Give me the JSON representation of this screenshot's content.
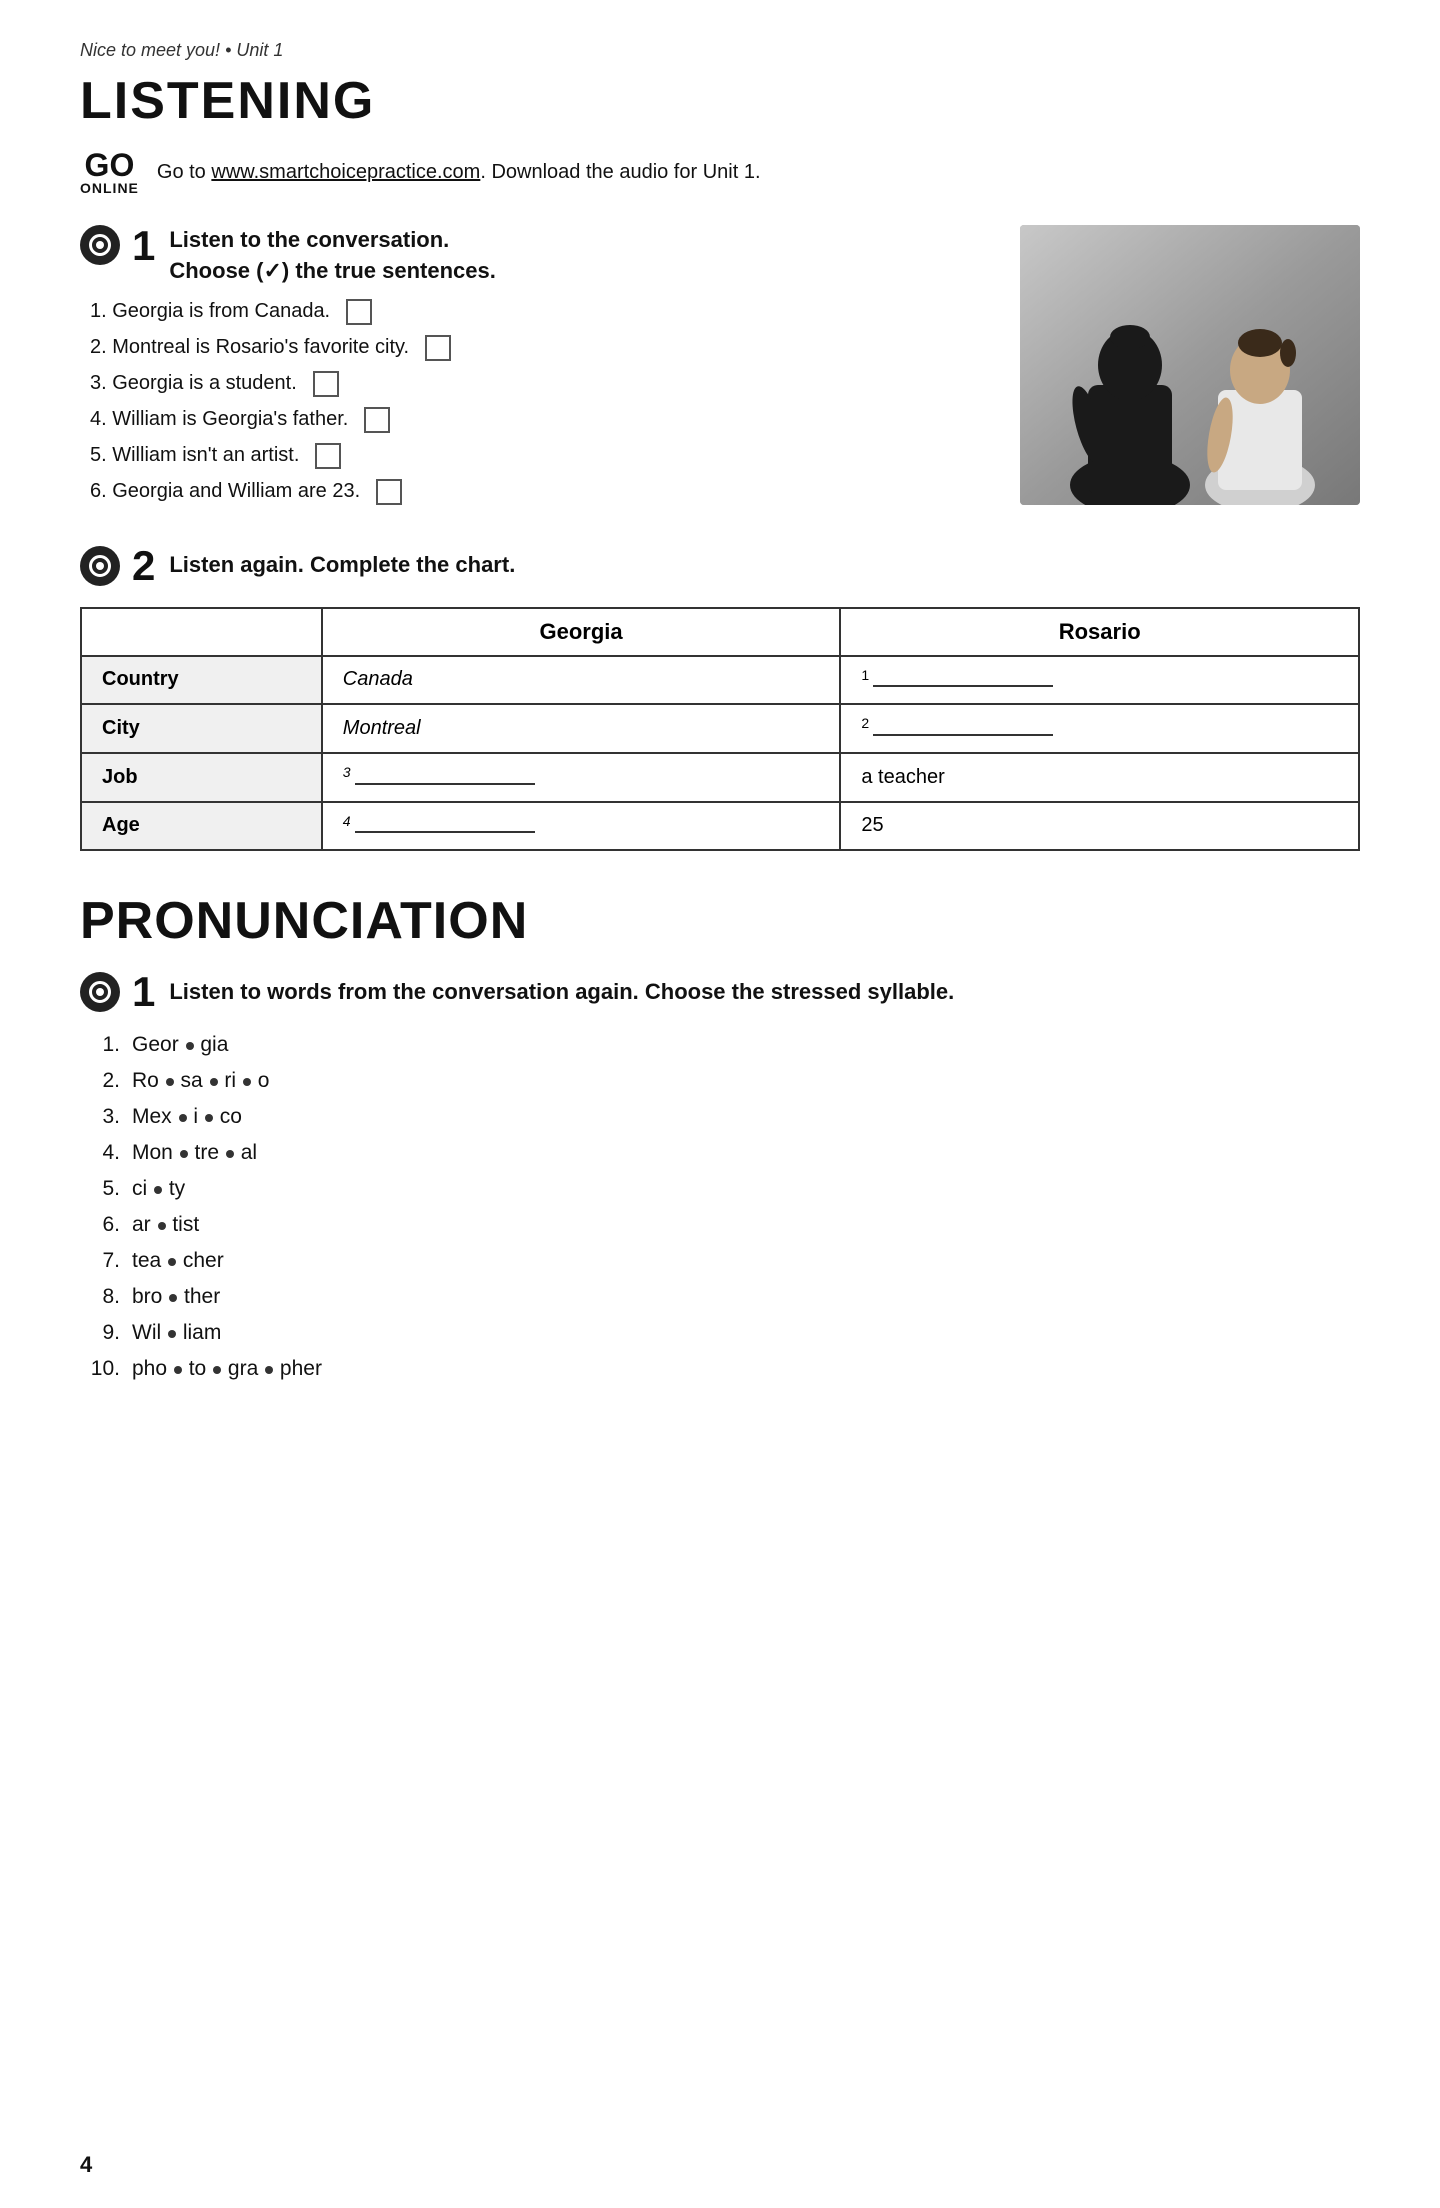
{
  "breadcrumb": "Nice to meet you! • Unit 1",
  "section1": {
    "title": "LISTENING",
    "go_online": {
      "go": "GO",
      "online": "ONLINE",
      "description": "Go to ",
      "url": "www.smartchoicepractice.com",
      "rest": ". Download the audio for Unit 1."
    },
    "exercise1": {
      "number": "1",
      "instruction_line1": "Listen to the conversation.",
      "instruction_line2": "Choose (✓) the true sentences.",
      "items": [
        "1.  Georgia is from Canada.",
        "2.  Montreal is Rosario's favorite city.",
        "3.  Georgia is a student.",
        "4.  William is Georgia's father.",
        "5.  William isn't an artist.",
        "6.  Georgia and William are 23."
      ]
    },
    "exercise2": {
      "number": "2",
      "instruction": "Listen again. Complete the chart.",
      "table": {
        "headers": [
          "",
          "Georgia",
          "Rosario"
        ],
        "rows": [
          {
            "label": "Country",
            "georgia": "Canada",
            "rosario": "1",
            "rosario_blank": true
          },
          {
            "label": "City",
            "georgia": "Montreal",
            "rosario": "2",
            "rosario_blank": true
          },
          {
            "label": "Job",
            "georgia": "3",
            "georgia_blank": true,
            "rosario": "a teacher"
          },
          {
            "label": "Age",
            "georgia": "4",
            "georgia_blank": true,
            "rosario": "25"
          }
        ]
      }
    }
  },
  "section2": {
    "title": "PRONUNCIATION",
    "exercise1": {
      "number": "1",
      "instruction": "Listen to words from the conversation again. Choose the stressed syllable.",
      "items": [
        {
          "num": "1.",
          "parts": [
            "Geor",
            "gia"
          ]
        },
        {
          "num": "2.",
          "parts": [
            "Ro",
            "sa",
            "ri",
            "o"
          ]
        },
        {
          "num": "3.",
          "parts": [
            "Mex",
            "i",
            "co"
          ]
        },
        {
          "num": "4.",
          "parts": [
            "Mon",
            "tre",
            "al"
          ]
        },
        {
          "num": "5.",
          "parts": [
            "ci",
            "ty"
          ]
        },
        {
          "num": "6.",
          "parts": [
            "ar",
            "tist"
          ]
        },
        {
          "num": "7.",
          "parts": [
            "tea",
            "cher"
          ]
        },
        {
          "num": "8.",
          "parts": [
            "bro",
            "ther"
          ]
        },
        {
          "num": "9.",
          "parts": [
            "Wil",
            "liam"
          ]
        },
        {
          "num": "10.",
          "parts": [
            "pho",
            "to",
            "gra",
            "pher"
          ]
        }
      ]
    }
  },
  "page_number": "4"
}
